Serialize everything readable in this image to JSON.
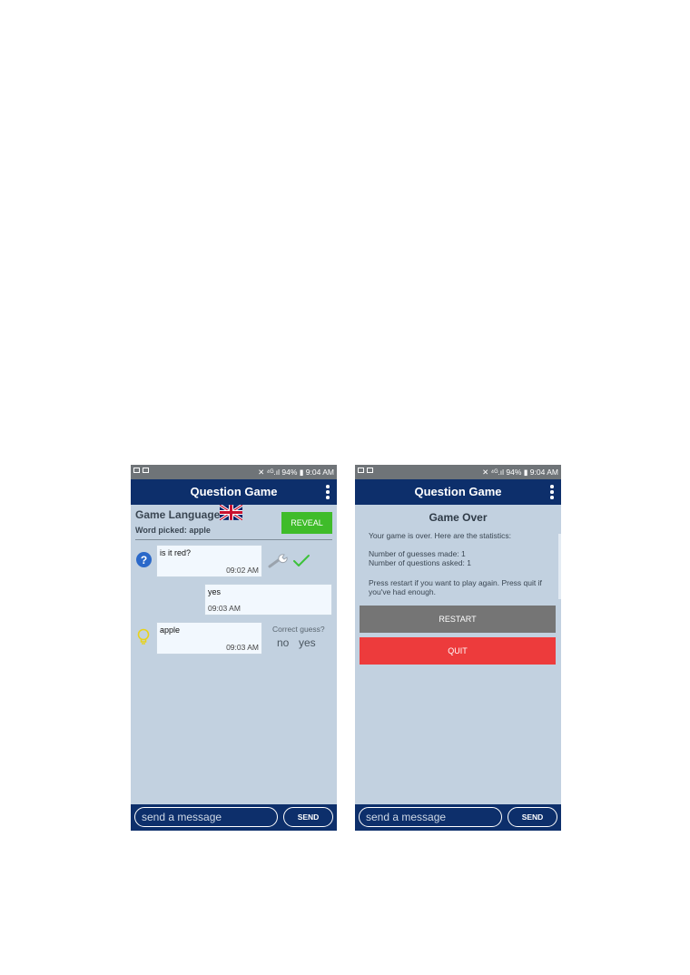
{
  "status_bar": {
    "right_text": "94% ▮ 9:04 AM",
    "right_prefix": "✕ ⁴ᴳ.ıl "
  },
  "left_screen": {
    "title": "Question Game",
    "game_language_label": "Game Language:",
    "word_picked": "Word picked: apple",
    "reveal_label": "REVEAL",
    "messages": [
      {
        "text": "is it red?",
        "time": "09:02 AM"
      },
      {
        "text": "yes",
        "time": "09:03 AM"
      },
      {
        "text": "apple",
        "time": "09:03 AM"
      }
    ],
    "correct_guess_label": "Correct guess?",
    "no_label": "no",
    "yes_label": "yes",
    "input_placeholder": "send a message",
    "send_label": "SEND"
  },
  "right_screen": {
    "title": "Question Game",
    "heading": "Game Over",
    "line1": "Your game is over. Here are the statistics:",
    "guesses": "Number of guesses made: 1",
    "questions": "Number of questions asked: 1",
    "restart_note": "Press restart if you want to play again. Press quit if you've had enough.",
    "restart_label": "RESTART",
    "quit_label": "QUIT",
    "input_placeholder": "send a message",
    "send_label": "SEND"
  },
  "colors": {
    "app_bar": "#0d2f6b",
    "background": "#c2d1e0",
    "reveal": "#3fbc2a",
    "restart": "#757575",
    "quit": "#ed3b3c"
  },
  "icons": [
    "question-icon",
    "wrench-icon",
    "check-icon",
    "lightbulb-icon",
    "uk-flag-icon",
    "more-vert-icon"
  ]
}
